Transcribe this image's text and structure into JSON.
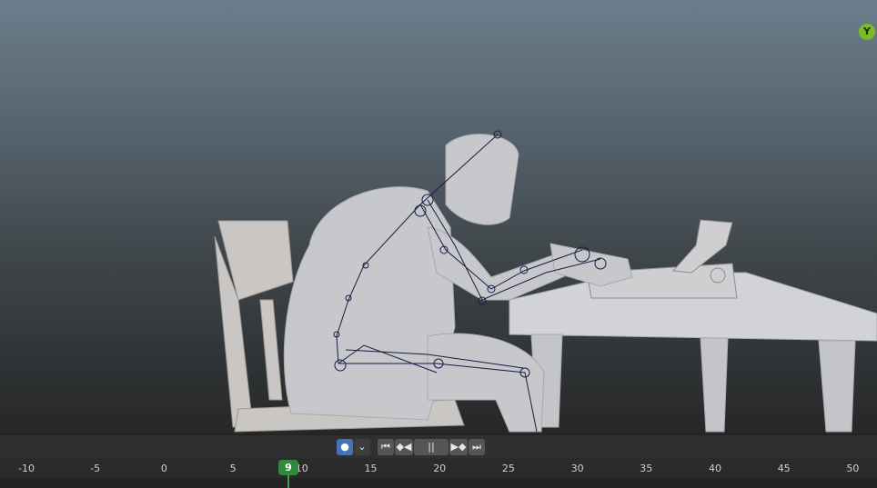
{
  "viewport": {
    "axis_gizmo_label": "Y"
  },
  "playback": {
    "record_icon": "●",
    "record_menu_icon": "⌄",
    "jump_start_icon": "⏮",
    "prev_keyframe_icon": "◆◀",
    "play_icon": "||",
    "next_keyframe_icon": "▶◆",
    "jump_end_icon": "⏭"
  },
  "timeline": {
    "current_frame": "9",
    "ticks": [
      "-10",
      "-5",
      "0",
      "5",
      "10",
      "15",
      "20",
      "25",
      "30",
      "35",
      "40",
      "45",
      "50"
    ]
  },
  "colors": {
    "accent_record": "#4772b3",
    "playhead": "#2f8a3d",
    "axis_y": "#7bbb24"
  }
}
